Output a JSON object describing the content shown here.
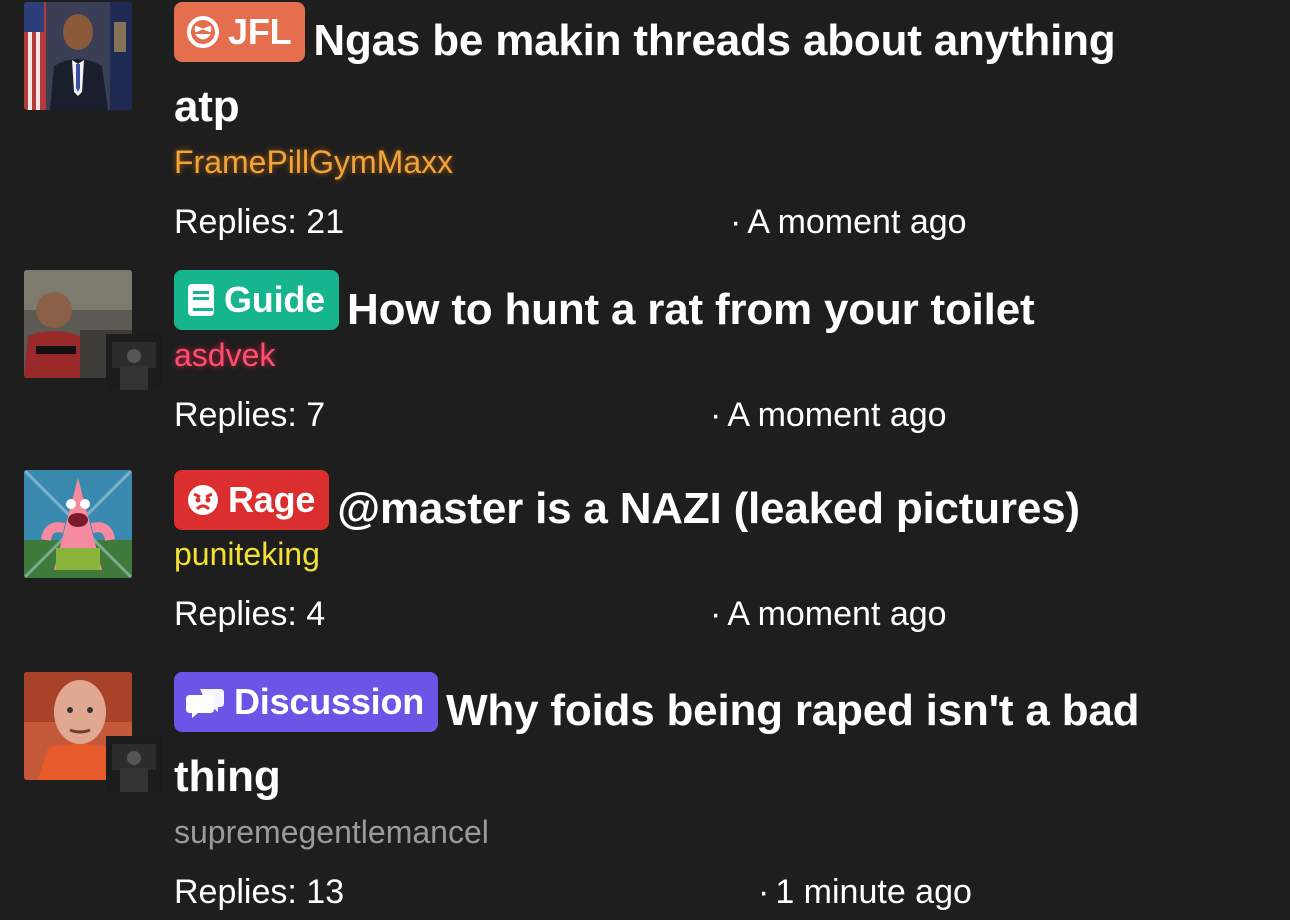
{
  "colors": {
    "background": "#1e1e1e",
    "tag_jfl": "#e56e4f",
    "tag_guide": "#16b58e",
    "tag_rage": "#db2f2f",
    "tag_discussion": "#6a55e6",
    "author_orange": "#f2a33a",
    "author_pink": "#ff4f6e",
    "author_yellow": "#f4e034",
    "author_gray": "#9a9a9a"
  },
  "separator": "·",
  "threads": [
    {
      "tag": {
        "label": "JFL",
        "icon": "laughing-face-icon"
      },
      "title_line1": "Ngas be makin threads about anything",
      "title_line2": "atp",
      "author": "FramePillGymMaxx",
      "replies": "Replies: 21",
      "time": "A moment ago"
    },
    {
      "tag": {
        "label": "Guide",
        "icon": "book-icon"
      },
      "title_line1": "How to hunt a rat from your toilet",
      "author": "asdvek",
      "replies": "Replies: 7",
      "time": "A moment ago"
    },
    {
      "tag": {
        "label": "Rage",
        "icon": "angry-face-icon"
      },
      "title_line1": "@master is a NAZI (leaked pictures)",
      "author": "puniteking",
      "replies": "Replies: 4",
      "time": "A moment ago"
    },
    {
      "tag": {
        "label": "Discussion",
        "icon": "chat-bubbles-icon"
      },
      "title_line1": "Why foids being raped isn't a bad",
      "title_line2": "thing",
      "author": "supremegentlemancel",
      "replies": "Replies: 13",
      "time": "1 minute ago"
    }
  ]
}
